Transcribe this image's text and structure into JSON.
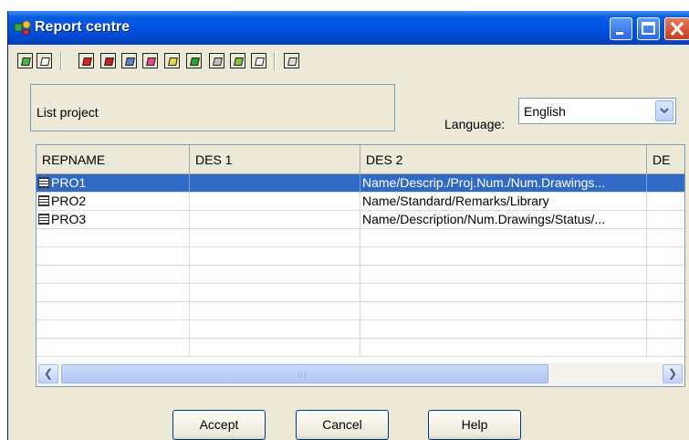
{
  "window": {
    "title": "Report centre"
  },
  "toolbar": {
    "buttons": [
      {
        "name": "new-icon",
        "color": "#49b649"
      },
      {
        "name": "open-icon",
        "color": "#ffffff"
      },
      {
        "name": "report-red-icon",
        "color": "#d52525"
      },
      {
        "name": "report-red2-icon",
        "color": "#c81e1e"
      },
      {
        "name": "report-blue-icon",
        "color": "#5a7fd6"
      },
      {
        "name": "report-pink-icon",
        "color": "#e04d8a"
      },
      {
        "name": "report-yellow-icon",
        "color": "#e8d44a"
      },
      {
        "name": "report-green-icon",
        "color": "#2e9b3a"
      },
      {
        "name": "report-grey-icon",
        "color": "#bdbdbd"
      },
      {
        "name": "report-lime-icon",
        "color": "#7cc242"
      },
      {
        "name": "report-list-icon",
        "color": "#f0f0f0"
      },
      {
        "name": "print-icon",
        "color": "#dcdcdc"
      }
    ]
  },
  "list_box": {
    "label": "List project"
  },
  "language": {
    "label": "Language:",
    "value": "English"
  },
  "grid": {
    "columns": [
      "REPNAME",
      "DES 1",
      "DES 2",
      "DE"
    ],
    "rows": [
      {
        "repname": "PRO1",
        "des1": "",
        "des2": "Name/Descrip./Proj.Num./Num.Drawings...",
        "selected": true
      },
      {
        "repname": "PRO2",
        "des1": "",
        "des2": "Name/Standard/Remarks/Library",
        "selected": false
      },
      {
        "repname": "PRO3",
        "des1": "",
        "des2": "Name/Description/Num.Drawings/Status/...",
        "selected": false
      }
    ],
    "empty_rows": 7,
    "scroll_grip": "III"
  },
  "buttons": {
    "accept": "Accept",
    "cancel": "Cancel",
    "help": "Help"
  }
}
